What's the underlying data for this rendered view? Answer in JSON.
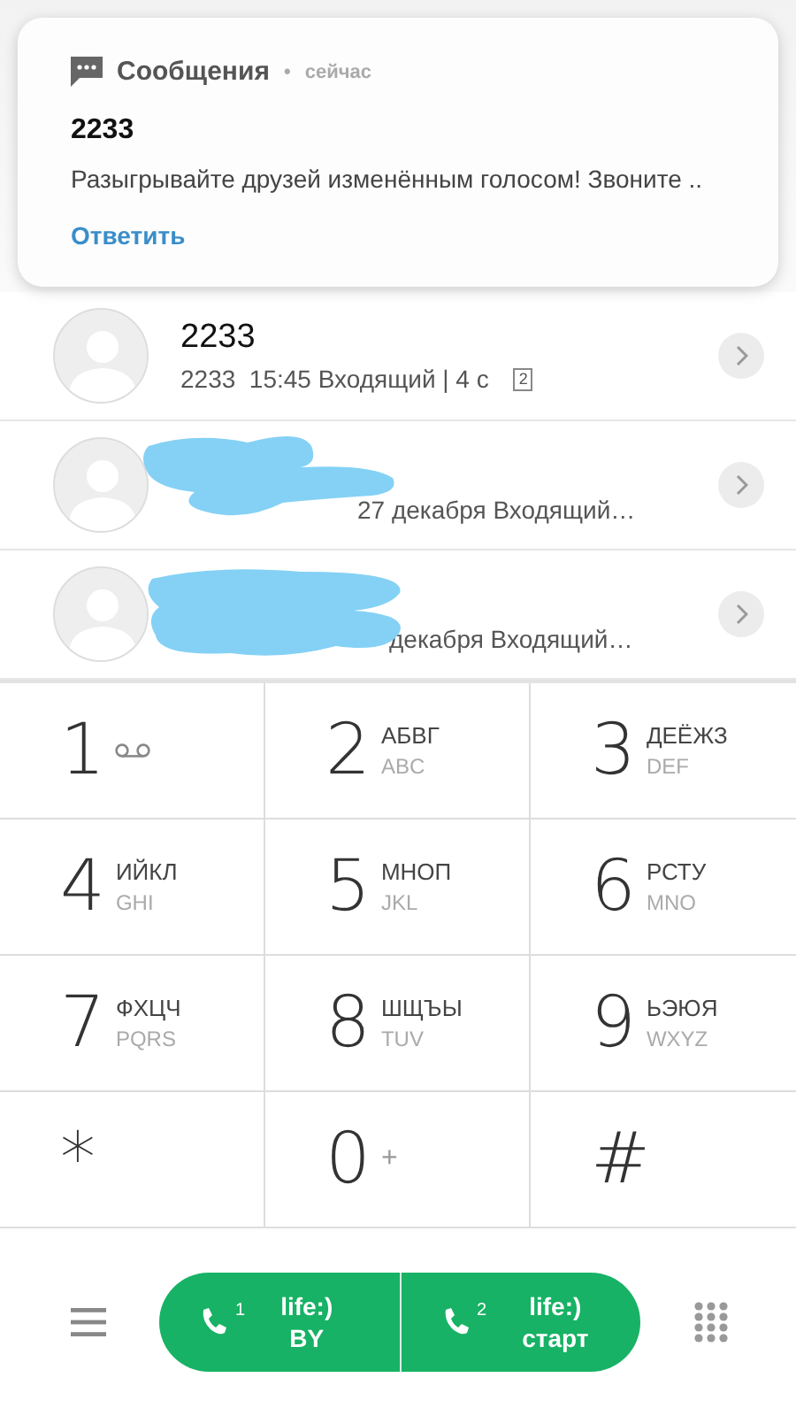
{
  "notification": {
    "app": "Сообщения",
    "separator": "•",
    "time": "сейчас",
    "title": "2233",
    "text": "Разыгрывайте друзей изменённым голосом! Звоните ..",
    "action": "Ответить"
  },
  "calls": [
    {
      "name": "2233",
      "detail": "2233  15:45 Входящий | 4 с",
      "sim": "2",
      "redacted": false
    },
    {
      "detail": "27 декабря Входящий…",
      "redacted": true
    },
    {
      "detail": "декабря Входящий…",
      "redacted": true
    }
  ],
  "keypad": [
    {
      "digit": "1",
      "kind": "voicemail"
    },
    {
      "digit": "2",
      "letters": "АБВГ",
      "latin": "ABC",
      "kind": "letters"
    },
    {
      "digit": "3",
      "letters": "ДЕЁЖЗ",
      "latin": "DEF",
      "kind": "letters"
    },
    {
      "digit": "4",
      "letters": "ИЙКЛ",
      "latin": "GHI",
      "kind": "letters"
    },
    {
      "digit": "5",
      "letters": "МНОП",
      "latin": "JKL",
      "kind": "letters"
    },
    {
      "digit": "6",
      "letters": "РСТУ",
      "latin": "MNO",
      "kind": "letters"
    },
    {
      "digit": "7",
      "letters": "ФХЦЧ",
      "latin": "PQRS",
      "kind": "letters"
    },
    {
      "digit": "8",
      "letters": "ШЩЪЫ",
      "latin": "TUV",
      "kind": "letters"
    },
    {
      "digit": "9",
      "letters": "ЬЭЮЯ",
      "latin": "WXYZ",
      "kind": "letters"
    },
    {
      "digit": "*",
      "kind": "symbol"
    },
    {
      "digit": "0",
      "plus": "+",
      "kind": "plus"
    },
    {
      "digit": "#",
      "kind": "symbol"
    }
  ],
  "sims": [
    {
      "slot": "1",
      "line1": "life:)",
      "line2": "BY"
    },
    {
      "slot": "2",
      "line1": "life:)",
      "line2": "старт"
    }
  ]
}
